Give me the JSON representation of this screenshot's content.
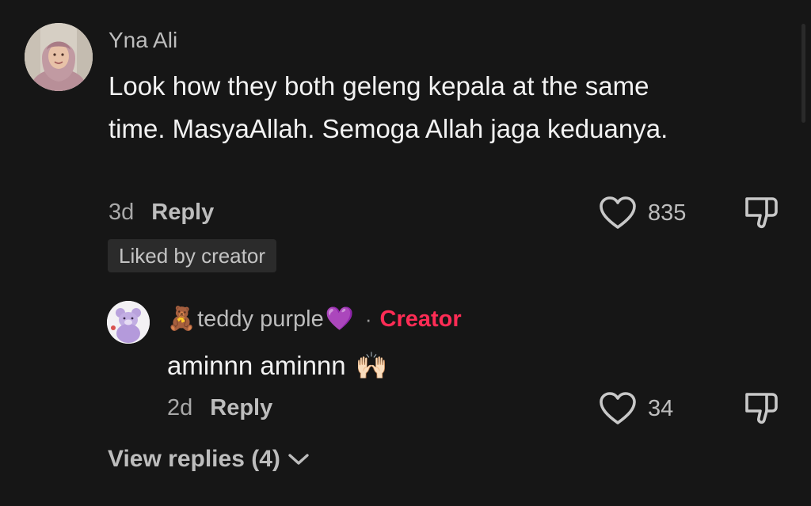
{
  "comment": {
    "username": "Yna Ali",
    "text": "Look how they both geleng kepala at the same time. MasyaAllah. Semoga Allah jaga keduanya.",
    "time": "3d",
    "reply_label": "Reply",
    "like_count": "835",
    "liked_badge": "Liked by creator",
    "avatar": "woman-in-hijab-avatar"
  },
  "reply": {
    "username": "teddy purple",
    "username_prefix_emoji": "🧸",
    "username_suffix_emoji": "💜",
    "separator": "·",
    "badge": "Creator",
    "text": "aminnn aminnn",
    "text_emoji": "🙌🏻",
    "time": "2d",
    "reply_label": "Reply",
    "like_count": "34",
    "avatar": "purple-teddy-bear-avatar"
  },
  "view_replies": {
    "label": "View replies (4)",
    "icon": "chevron-down-icon"
  },
  "colors": {
    "background": "#161616",
    "creator_badge": "#fe2c55",
    "secondary_text": "#bdbdbd",
    "badge_background": "#2b2b2b"
  }
}
